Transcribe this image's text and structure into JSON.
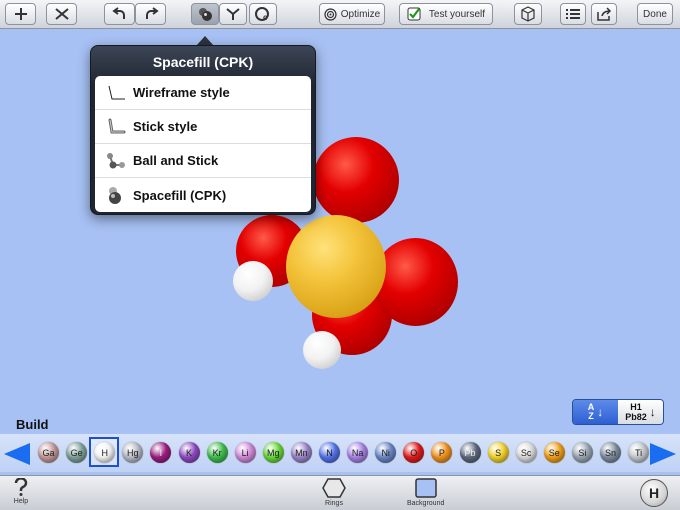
{
  "toolbar": {
    "buttons": [
      {
        "icon": "plus-icon"
      },
      {
        "icon": "delete-bond-icon"
      },
      {
        "icon": "undo-icon"
      },
      {
        "icon": "redo-icon"
      },
      {
        "icon": "display-style-icon",
        "active": true
      },
      {
        "icon": "bond-tool-icon"
      },
      {
        "icon": "charge-tool-icon"
      }
    ],
    "optimize_label": "Optimize",
    "test_label": "Test yourself",
    "done_label": "Done"
  },
  "popover": {
    "title": "Spacefill (CPK)",
    "items": [
      {
        "label": "Wireframe style",
        "icon": "wireframe-icon"
      },
      {
        "label": "Stick style",
        "icon": "stick-icon"
      },
      {
        "label": "Ball and Stick",
        "icon": "ball-and-stick-icon"
      },
      {
        "label": "Spacefill (CPK)",
        "icon": "spacefill-icon"
      }
    ]
  },
  "molecule": {
    "atoms": [
      "O",
      "O",
      "O",
      "O",
      "S",
      "H",
      "H"
    ],
    "colors": {
      "O": "#e30000",
      "S": "#f4c43c",
      "H": "#f2f2f2"
    }
  },
  "sort": {
    "az_top": "A",
    "az_bottom": "Z",
    "num_top": "H1",
    "num_bottom": "Pb82"
  },
  "build": {
    "label": "Build",
    "selected": "H",
    "elements": [
      {
        "symbol": "Ga",
        "color": "#c49a9a"
      },
      {
        "symbol": "Ge",
        "color": "#7fa39a"
      },
      {
        "symbol": "H",
        "color": "#f4f4f4"
      },
      {
        "symbol": "Hg",
        "color": "#b9bcc7"
      },
      {
        "symbol": "I",
        "color": "#9b1f7f"
      },
      {
        "symbol": "K",
        "color": "#8e4bc2"
      },
      {
        "symbol": "Kr",
        "color": "#3fc04b"
      },
      {
        "symbol": "Li",
        "color": "#d28ad8"
      },
      {
        "symbol": "Mg",
        "color": "#69d83a"
      },
      {
        "symbol": "Mn",
        "color": "#9b86c8"
      },
      {
        "symbol": "N",
        "color": "#5473e8"
      },
      {
        "symbol": "Na",
        "color": "#a983e6"
      },
      {
        "symbol": "Ni",
        "color": "#6c88c8"
      },
      {
        "symbol": "O",
        "color": "#e01c1c"
      },
      {
        "symbol": "P",
        "color": "#f0921e"
      },
      {
        "symbol": "Pb",
        "color": "#606a7e"
      },
      {
        "symbol": "S",
        "color": "#f2d22a"
      },
      {
        "symbol": "Sc",
        "color": "#dcdcdc"
      },
      {
        "symbol": "Se",
        "color": "#f0a018"
      },
      {
        "symbol": "Si",
        "color": "#9aa6b4"
      },
      {
        "symbol": "Sn",
        "color": "#7e8ea0"
      },
      {
        "symbol": "Ti",
        "color": "#c4c8cc"
      }
    ]
  },
  "bottombar": {
    "help_label": "Help",
    "rings_label": "Rings",
    "background_label": "Background",
    "h_label": "H"
  }
}
